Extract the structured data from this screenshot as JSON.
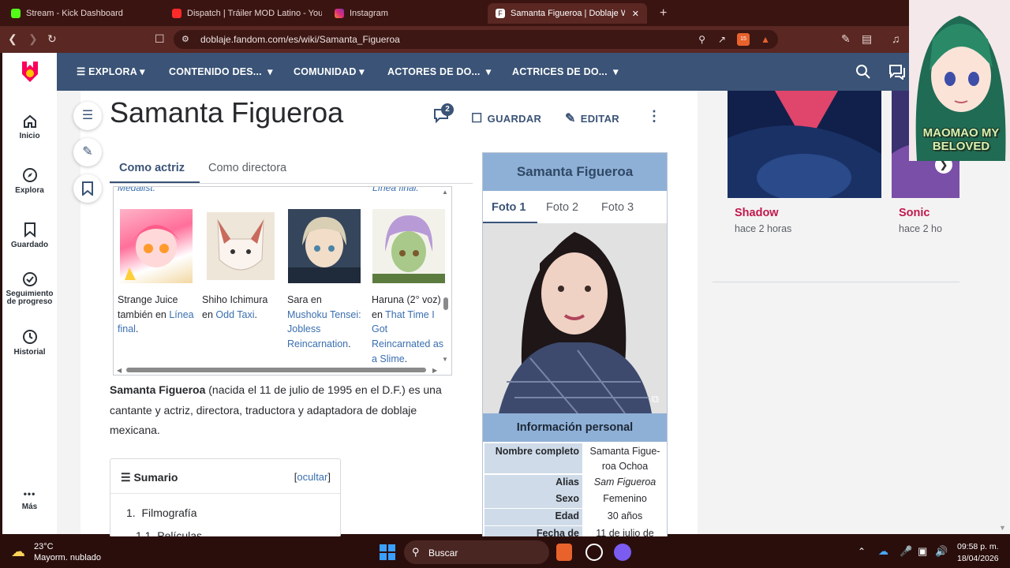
{
  "browser": {
    "tabs": [
      {
        "title": "Stream - Kick Dashboard",
        "color": "#53fc18"
      },
      {
        "title": "Dispatch | Tráiler MOD Latino - YouTu",
        "color": "#ff2a2a"
      },
      {
        "title": "Instagram",
        "color": "#e1306c"
      },
      {
        "title": "Samanta Figueroa | Doblaje Wiki",
        "color": "#ffffff"
      }
    ],
    "new_tab": "+",
    "close": "✕",
    "url": "doblaje.fandom.com/es/wiki/Samanta_Figueroa",
    "shield_count": "15"
  },
  "siderail": {
    "items": [
      {
        "label": "Inicio",
        "icon": "home-icon"
      },
      {
        "label": "Explora",
        "icon": "compass-icon"
      },
      {
        "label": "Guardado",
        "icon": "bookmark-icon"
      },
      {
        "label": "Seguimiento de progreso",
        "icon": "check-circle-icon"
      },
      {
        "label": "Historial",
        "icon": "history-icon"
      },
      {
        "label": "Más",
        "icon": "more-icon"
      }
    ],
    "more_glyph": "•••"
  },
  "topnav": {
    "items": [
      "EXPLORA",
      "CONTENIDO DES...",
      "COMUNIDAD",
      "ACTORES DE DO...",
      "ACTRICES DE DO..."
    ]
  },
  "page": {
    "title": "Samanta Figueroa",
    "comments_count": "2",
    "save_label": "GUARDAR",
    "edit_label": "EDITAR",
    "content_tabs": [
      "Como actriz",
      "Como directora"
    ],
    "gallery_top_left": "Medalist.",
    "gallery_top_right": "Línea final.",
    "gallery": [
      {
        "pre": "Strange Juice también en",
        "link": "Línea final",
        "post": "."
      },
      {
        "pre": "Shiho Ichimura en",
        "link": "Odd Taxi",
        "post": "."
      },
      {
        "pre": "Sara en",
        "link": "Mushoku Tensei: Jobless Reincarnation",
        "post": "."
      },
      {
        "pre": "Haruna (2° voz) en",
        "link": "That Time I Got Reincarnated as a Slime",
        "post": "."
      }
    ],
    "intro_bold": "Samanta Figueroa",
    "intro_rest": " (nacida el 11 de julio de 1995 en el D.F.) es una cantante y actriz, directora, traductora y adaptadora de doblaje mexicana.",
    "toc_title": "Sumario",
    "toc_hide": "ocultar",
    "toc_items": [
      "1.  Filmografía",
      "1.1  Películas"
    ]
  },
  "infobox": {
    "title": "Samanta Figueroa",
    "photo_tabs": [
      "Foto 1",
      "Foto 2",
      "Foto 3"
    ],
    "section": "Información personal",
    "rows": [
      {
        "k": "Nombre completo",
        "v": "Samanta Figue-roa Ochoa"
      },
      {
        "k": "Alias",
        "v": "Sam Figueroa"
      },
      {
        "k": "Sexo",
        "v": "Femenino"
      },
      {
        "k": "Edad",
        "v": "30 años"
      },
      {
        "k": "Fecha de",
        "v": "11 de julio de"
      }
    ]
  },
  "rightcol": {
    "cards": [
      {
        "title": "Shadow",
        "time": "hace 2 horas"
      },
      {
        "title": "Sonic",
        "time": "hace 2 ho"
      }
    ]
  },
  "overlay": {
    "text": "MAOMAO MY BELOVED"
  },
  "taskbar": {
    "temp": "23°C",
    "weather": "Mayorm. nublado",
    "search": "Buscar",
    "time": "09:58 p. m.",
    "date": "18/04/2026"
  },
  "colors": {
    "accent": "#3a5376",
    "link": "#3a6fb0",
    "infobox_head": "#8fb0d6"
  }
}
